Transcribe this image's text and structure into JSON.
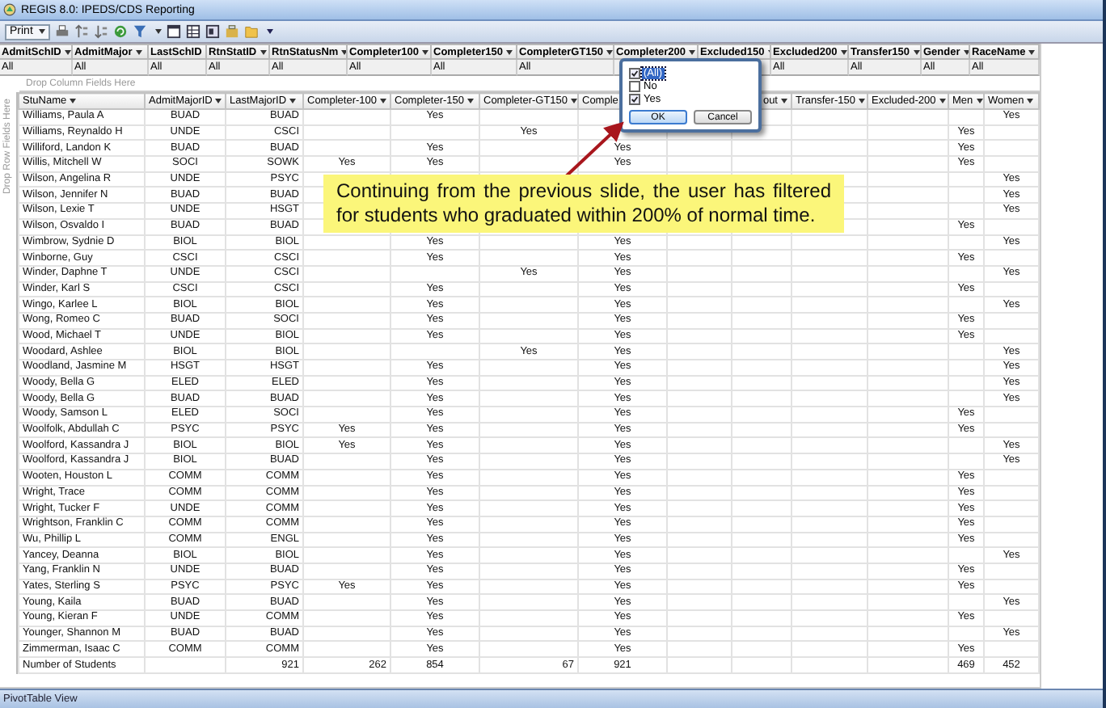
{
  "window": {
    "title": "REGIS 8.0:  IPEDS/CDS Reporting"
  },
  "toolbar": {
    "print_label": "Print"
  },
  "filter_fields": [
    {
      "label": "AdmitSchID",
      "value": "All"
    },
    {
      "label": "AdmitMajor",
      "value": "All"
    },
    {
      "label": "LastSchID",
      "value": "All"
    },
    {
      "label": "RtnStatID",
      "value": "All"
    },
    {
      "label": "RtnStatusNm",
      "value": "All"
    },
    {
      "label": "Completer100",
      "value": "All"
    },
    {
      "label": "Completer150",
      "value": "All"
    },
    {
      "label": "CompleterGT150",
      "value": "All"
    },
    {
      "label": "Completer200"
    },
    {
      "label": "Excluded150"
    },
    {
      "label": "Excluded200",
      "value": "All"
    },
    {
      "label": "Transfer150",
      "value": "All"
    },
    {
      "label": "Gender",
      "value": "All"
    },
    {
      "label": "RaceName",
      "value": "All"
    }
  ],
  "drop_column_hint": "Drop Column Fields Here",
  "drop_row_hint": "Drop Row Fields Here",
  "columns": [
    {
      "label": "StuName",
      "dropdown": true
    },
    {
      "label": "AdmitMajorID",
      "dropdown": true
    },
    {
      "label": "LastMajorID",
      "dropdown": true
    },
    {
      "label": "Completer-100",
      "dropdown": true
    },
    {
      "label": "Completer-150",
      "dropdown": true
    },
    {
      "label": "Completer-GT150",
      "dropdown": true
    },
    {
      "label": "Comple",
      "dropdown": false
    },
    {},
    {
      "label": "out",
      "dropdown": true
    },
    {
      "label": "Transfer-150",
      "dropdown": true
    },
    {
      "label": "Excluded-200",
      "dropdown": true
    },
    {
      "label": "Men",
      "dropdown": true
    },
    {
      "label": "Women",
      "dropdown": true
    }
  ],
  "rows": [
    {
      "cells": [
        "Williams, Paula A",
        "BUAD",
        "BUAD",
        null,
        "Yes",
        null,
        null,
        null,
        null,
        null,
        null,
        null,
        "Yes"
      ]
    },
    {
      "cells": [
        "Williams, Reynaldo H",
        "UNDE",
        "CSCI",
        null,
        null,
        "Yes",
        null,
        null,
        null,
        null,
        null,
        "Yes",
        null
      ]
    },
    {
      "cells": [
        "Williford, Landon K",
        "BUAD",
        "BUAD",
        null,
        "Yes",
        null,
        "Yes",
        null,
        null,
        null,
        null,
        "Yes",
        null
      ]
    },
    {
      "cells": [
        "Willis, Mitchell W",
        "SOCI",
        "SOWK",
        "Yes",
        "Yes",
        null,
        "Yes",
        null,
        null,
        null,
        null,
        "Yes",
        null
      ]
    },
    {
      "cells": [
        "Wilson, Angelina R",
        "UNDE",
        "PSYC",
        null,
        null,
        null,
        null,
        null,
        null,
        null,
        null,
        null,
        "Yes"
      ]
    },
    {
      "cells": [
        "Wilson, Jennifer N",
        "BUAD",
        "BUAD",
        null,
        null,
        null,
        null,
        null,
        null,
        null,
        null,
        null,
        "Yes"
      ]
    },
    {
      "cells": [
        "Wilson, Lexie T",
        "UNDE",
        "HSGT",
        null,
        null,
        null,
        null,
        null,
        null,
        null,
        null,
        null,
        "Yes"
      ]
    },
    {
      "cells": [
        "Wilson, Osvaldo I",
        "BUAD",
        "BUAD",
        null,
        null,
        null,
        null,
        null,
        null,
        null,
        null,
        "Yes",
        null
      ]
    },
    {
      "cells": [
        "Wimbrow, Sydnie D",
        "BIOL",
        "BIOL",
        null,
        "Yes",
        null,
        "Yes",
        null,
        null,
        null,
        null,
        null,
        "Yes"
      ]
    },
    {
      "cells": [
        "Winborne, Guy",
        "CSCI",
        "CSCI",
        null,
        "Yes",
        null,
        "Yes",
        null,
        null,
        null,
        null,
        "Yes",
        null
      ]
    },
    {
      "cells": [
        "Winder, Daphne T",
        "UNDE",
        "CSCI",
        null,
        null,
        "Yes",
        "Yes",
        null,
        null,
        null,
        null,
        null,
        "Yes"
      ]
    },
    {
      "cells": [
        "Winder, Karl S",
        "CSCI",
        "CSCI",
        null,
        "Yes",
        null,
        "Yes",
        null,
        null,
        null,
        null,
        "Yes",
        null
      ]
    },
    {
      "cells": [
        "Wingo, Karlee L",
        "BIOL",
        "BIOL",
        null,
        "Yes",
        null,
        "Yes",
        null,
        null,
        null,
        null,
        null,
        "Yes"
      ]
    },
    {
      "cells": [
        "Wong, Romeo C",
        "BUAD",
        "SOCI",
        null,
        "Yes",
        null,
        "Yes",
        null,
        null,
        null,
        null,
        "Yes",
        null
      ]
    },
    {
      "cells": [
        "Wood, Michael T",
        "UNDE",
        "BIOL",
        null,
        "Yes",
        null,
        "Yes",
        null,
        null,
        null,
        null,
        "Yes",
        null
      ]
    },
    {
      "cells": [
        "Woodard, Ashlee",
        "BIOL",
        "BIOL",
        null,
        null,
        "Yes",
        "Yes",
        null,
        null,
        null,
        null,
        null,
        "Yes"
      ]
    },
    {
      "cells": [
        "Woodland, Jasmine M",
        "HSGT",
        "HSGT",
        null,
        "Yes",
        null,
        "Yes",
        null,
        null,
        null,
        null,
        null,
        "Yes"
      ]
    },
    {
      "cells": [
        "Woody, Bella G",
        "ELED",
        "ELED",
        null,
        "Yes",
        null,
        "Yes",
        null,
        null,
        null,
        null,
        null,
        "Yes"
      ]
    },
    {
      "cells": [
        "Woody, Bella G",
        "BUAD",
        "BUAD",
        null,
        "Yes",
        null,
        "Yes",
        null,
        null,
        null,
        null,
        null,
        "Yes"
      ]
    },
    {
      "cells": [
        "Woody, Samson L",
        "ELED",
        "SOCI",
        null,
        "Yes",
        null,
        "Yes",
        null,
        null,
        null,
        null,
        "Yes",
        null
      ]
    },
    {
      "cells": [
        "Woolfolk, Abdullah C",
        "PSYC",
        "PSYC",
        "Yes",
        "Yes",
        null,
        "Yes",
        null,
        null,
        null,
        null,
        "Yes",
        null
      ]
    },
    {
      "cells": [
        "Woolford, Kassandra J",
        "BIOL",
        "BIOL",
        "Yes",
        "Yes",
        null,
        "Yes",
        null,
        null,
        null,
        null,
        null,
        "Yes"
      ]
    },
    {
      "cells": [
        "Woolford, Kassandra J",
        "BIOL",
        "BUAD",
        null,
        "Yes",
        null,
        "Yes",
        null,
        null,
        null,
        null,
        null,
        "Yes"
      ]
    },
    {
      "cells": [
        "Wooten, Houston L",
        "COMM",
        "COMM",
        null,
        "Yes",
        null,
        "Yes",
        null,
        null,
        null,
        null,
        "Yes",
        null
      ]
    },
    {
      "cells": [
        "Wright, Trace",
        "COMM",
        "COMM",
        null,
        "Yes",
        null,
        "Yes",
        null,
        null,
        null,
        null,
        "Yes",
        null
      ]
    },
    {
      "cells": [
        "Wright, Tucker F",
        "UNDE",
        "COMM",
        null,
        "Yes",
        null,
        "Yes",
        null,
        null,
        null,
        null,
        "Yes",
        null
      ]
    },
    {
      "cells": [
        "Wrightson, Franklin C",
        "COMM",
        "COMM",
        null,
        "Yes",
        null,
        "Yes",
        null,
        null,
        null,
        null,
        "Yes",
        null
      ]
    },
    {
      "cells": [
        "Wu, Phillip L",
        "COMM",
        "ENGL",
        null,
        "Yes",
        null,
        "Yes",
        null,
        null,
        null,
        null,
        "Yes",
        null
      ]
    },
    {
      "cells": [
        "Yancey, Deanna",
        "BIOL",
        "BIOL",
        null,
        "Yes",
        null,
        "Yes",
        null,
        null,
        null,
        null,
        null,
        "Yes"
      ]
    },
    {
      "cells": [
        "Yang, Franklin N",
        "UNDE",
        "BUAD",
        null,
        "Yes",
        null,
        "Yes",
        null,
        null,
        null,
        null,
        "Yes",
        null
      ]
    },
    {
      "cells": [
        "Yates, Sterling S",
        "PSYC",
        "PSYC",
        "Yes",
        "Yes",
        null,
        "Yes",
        null,
        null,
        null,
        null,
        "Yes",
        null
      ]
    },
    {
      "cells": [
        "Young, Kaila",
        "BUAD",
        "BUAD",
        null,
        "Yes",
        null,
        "Yes",
        null,
        null,
        null,
        null,
        null,
        "Yes"
      ]
    },
    {
      "cells": [
        "Young, Kieran F",
        "UNDE",
        "COMM",
        null,
        "Yes",
        null,
        "Yes",
        null,
        null,
        null,
        null,
        "Yes",
        null
      ]
    },
    {
      "cells": [
        "Younger, Shannon M",
        "BUAD",
        "BUAD",
        null,
        "Yes",
        null,
        "Yes",
        null,
        null,
        null,
        null,
        null,
        "Yes"
      ]
    },
    {
      "cells": [
        "Zimmerman, Isaac C",
        "COMM",
        "COMM",
        null,
        "Yes",
        null,
        "Yes",
        null,
        null,
        null,
        null,
        "Yes",
        null
      ]
    }
  ],
  "total_row": {
    "cells": [
      "Number of Students",
      null,
      "921",
      "262",
      "854",
      "67",
      "921",
      null,
      null,
      null,
      null,
      "469",
      "452"
    ]
  },
  "filter_popup": {
    "items": [
      {
        "label": "(All)",
        "checked": true,
        "selected": true
      },
      {
        "label": "No",
        "checked": false,
        "selected": false
      },
      {
        "label": "Yes",
        "checked": true,
        "selected": false
      }
    ],
    "buttons": [
      "OK",
      "Cancel"
    ]
  },
  "callout": {
    "text": "Continuing from the previous slide, the user has filtered for students who graduated within 200% of normal time."
  },
  "status_bar": {
    "text": "PivotTable View"
  }
}
